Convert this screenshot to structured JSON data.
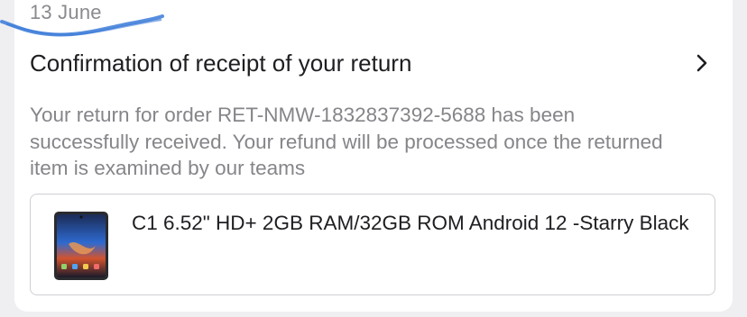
{
  "notification": {
    "date": "13 June",
    "title": "Confirmation of receipt of your return",
    "message": "Your return for order RET-NMW-1832837392-5688 has been successfully received. Your refund will be processed once the returned item is examined by our teams",
    "product": {
      "name": "C1 6.52\" HD+ 2GB RAM/32GB ROM Android 12 -Starry Black",
      "image_icon": "phone-image"
    },
    "chevron_icon": "chevron-right-icon"
  },
  "colors": {
    "scribble": "#3a7ad8",
    "secondary_text": "#85858a",
    "primary_text": "#1e1e22",
    "border": "#cfcfd4"
  }
}
